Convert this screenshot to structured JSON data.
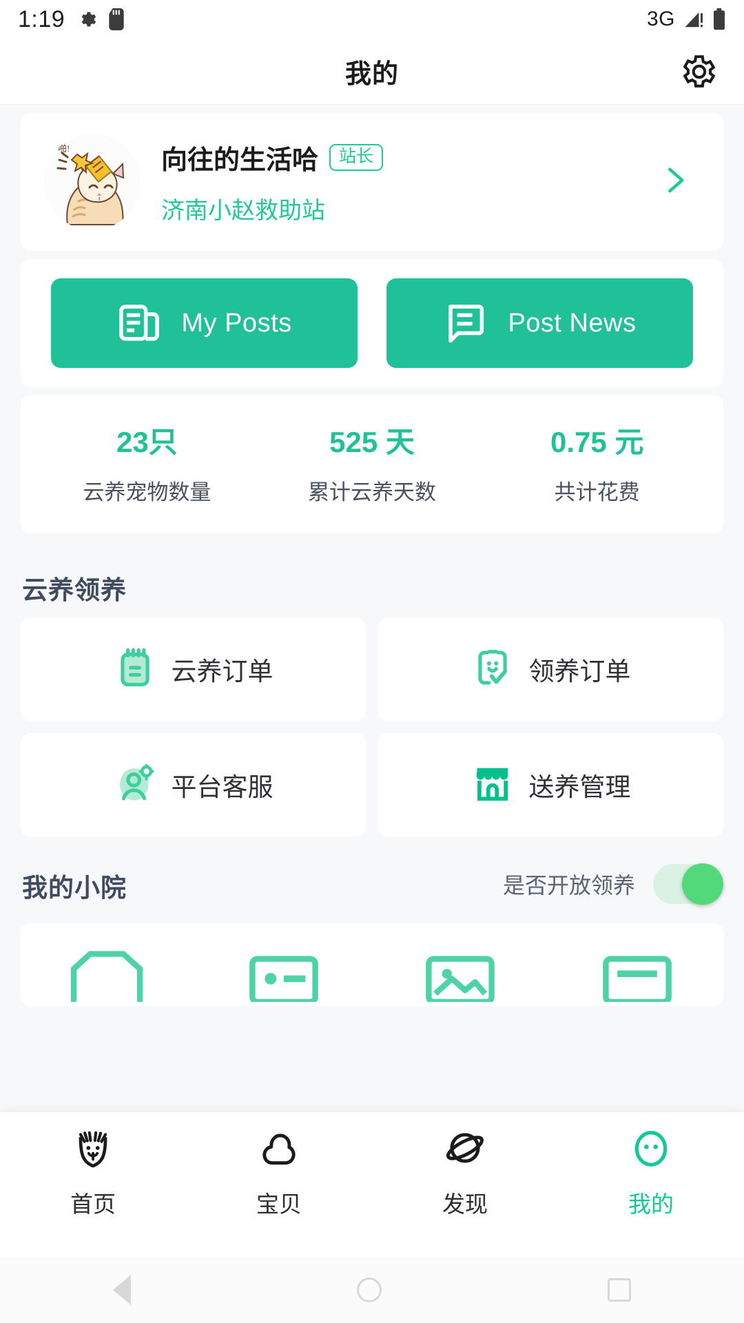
{
  "status_bar": {
    "time": "1:19",
    "network": "3G",
    "icons": [
      "gear-icon",
      "sd-card-icon",
      "signal-icon",
      "battery-icon"
    ]
  },
  "header": {
    "title": "我的",
    "settings_icon": "gear-icon"
  },
  "profile": {
    "name": "向往的生活哈",
    "badge": "站长",
    "station": "济南小赵救助站",
    "avatar_icon": "cat-avatar",
    "chevron_icon": "chevron-right-icon"
  },
  "actions": [
    {
      "label": "My Posts",
      "icon": "newspaper-icon"
    },
    {
      "label": "Post News",
      "icon": "comment-document-icon"
    }
  ],
  "stats": [
    {
      "value": "23只",
      "label": "云养宠物数量"
    },
    {
      "value": "525 天",
      "label": "累计云养天数"
    },
    {
      "value": "0.75 元",
      "label": "共计花费"
    }
  ],
  "adopt_section": {
    "title": "云养领养",
    "items": [
      {
        "label": "云养订单",
        "icon": "notepad-icon"
      },
      {
        "label": "领养订单",
        "icon": "smiley-check-icon"
      },
      {
        "label": "平台客服",
        "icon": "user-gear-icon"
      },
      {
        "label": "送养管理",
        "icon": "store-icon"
      }
    ]
  },
  "yard_section": {
    "title": "我的小院",
    "toggle_label": "是否开放领养",
    "toggle_on": true
  },
  "tabbar": [
    {
      "label": "首页",
      "icon": "cat-face-icon",
      "active": false
    },
    {
      "label": "宝贝",
      "icon": "cloud-paw-icon",
      "active": false
    },
    {
      "label": "发现",
      "icon": "planet-icon",
      "active": false
    },
    {
      "label": "我的",
      "icon": "face-icon",
      "active": true
    }
  ],
  "android_nav": [
    "back-button",
    "home-button",
    "recents-button"
  ],
  "colors": {
    "accent": "#20c198",
    "accent_light": "#9fe3c8",
    "toggle_on": "#52d979",
    "heading": "#404b62",
    "page_bg": "#f7f8f9"
  }
}
